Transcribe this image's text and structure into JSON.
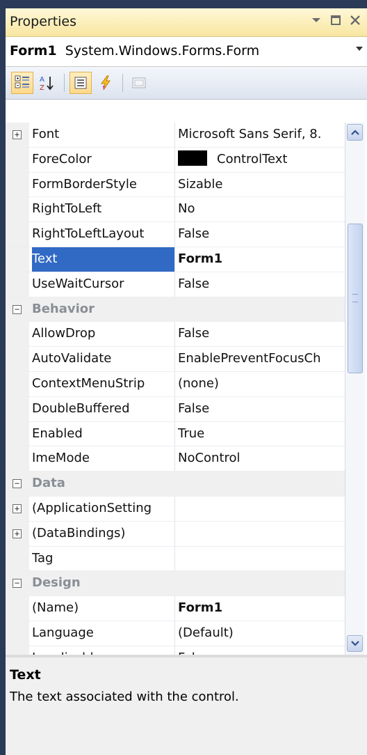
{
  "window": {
    "title": "Properties"
  },
  "titlebar_icons": [
    "pin-dropdown-icon",
    "maximize-icon",
    "close-icon"
  ],
  "object_selector": {
    "name": "Form1",
    "type": "System.Windows.Forms.Form"
  },
  "toolbar": {
    "tools": [
      {
        "icon": "categorized-icon",
        "active": true
      },
      {
        "icon": "alphabetical-icon",
        "active": false
      },
      {
        "icon": "properties-icon",
        "active": true
      },
      {
        "icon": "events-icon",
        "active": false
      },
      {
        "icon": "property-pages-icon",
        "active": false,
        "disabled": true
      }
    ]
  },
  "grid": {
    "rows": [
      {
        "kind": "prop",
        "name": "Font",
        "value": "Microsoft Sans Serif, 8.",
        "expander": "+"
      },
      {
        "kind": "prop",
        "name": "ForeColor",
        "value": "ControlText",
        "swatch": "#000000"
      },
      {
        "kind": "prop",
        "name": "FormBorderStyle",
        "value": "Sizable"
      },
      {
        "kind": "prop",
        "name": "RightToLeft",
        "value": "No"
      },
      {
        "kind": "prop",
        "name": "RightToLeftLayout",
        "value": "False"
      },
      {
        "kind": "prop",
        "name": "Text",
        "value": "Form1",
        "selected": true,
        "bold": true
      },
      {
        "kind": "prop",
        "name": "UseWaitCursor",
        "value": "False"
      },
      {
        "kind": "category",
        "name": "Behavior",
        "expander": "−"
      },
      {
        "kind": "prop",
        "name": "AllowDrop",
        "value": "False"
      },
      {
        "kind": "prop",
        "name": "AutoValidate",
        "value": "EnablePreventFocusCh"
      },
      {
        "kind": "prop",
        "name": "ContextMenuStrip",
        "value": "(none)"
      },
      {
        "kind": "prop",
        "name": "DoubleBuffered",
        "value": "False"
      },
      {
        "kind": "prop",
        "name": "Enabled",
        "value": "True"
      },
      {
        "kind": "prop",
        "name": "ImeMode",
        "value": "NoControl"
      },
      {
        "kind": "category",
        "name": "Data",
        "expander": "−"
      },
      {
        "kind": "prop",
        "name": "(ApplicationSetting",
        "value": "",
        "expander": "+"
      },
      {
        "kind": "prop",
        "name": "(DataBindings)",
        "value": "",
        "expander": "+"
      },
      {
        "kind": "prop",
        "name": "Tag",
        "value": ""
      },
      {
        "kind": "category",
        "name": "Design",
        "expander": "−"
      },
      {
        "kind": "prop",
        "name": "(Name)",
        "value": "Form1",
        "bold": true
      },
      {
        "kind": "prop",
        "name": "Language",
        "value": "(Default)"
      },
      {
        "kind": "prop",
        "name": "Localizable",
        "value": "False"
      }
    ]
  },
  "scrollbar": {
    "up_icon": "scroll-up-icon",
    "down_icon": "scroll-down-icon",
    "position_fraction": 0.26
  },
  "description": {
    "title": "Text",
    "text": "The text associated with the control."
  }
}
